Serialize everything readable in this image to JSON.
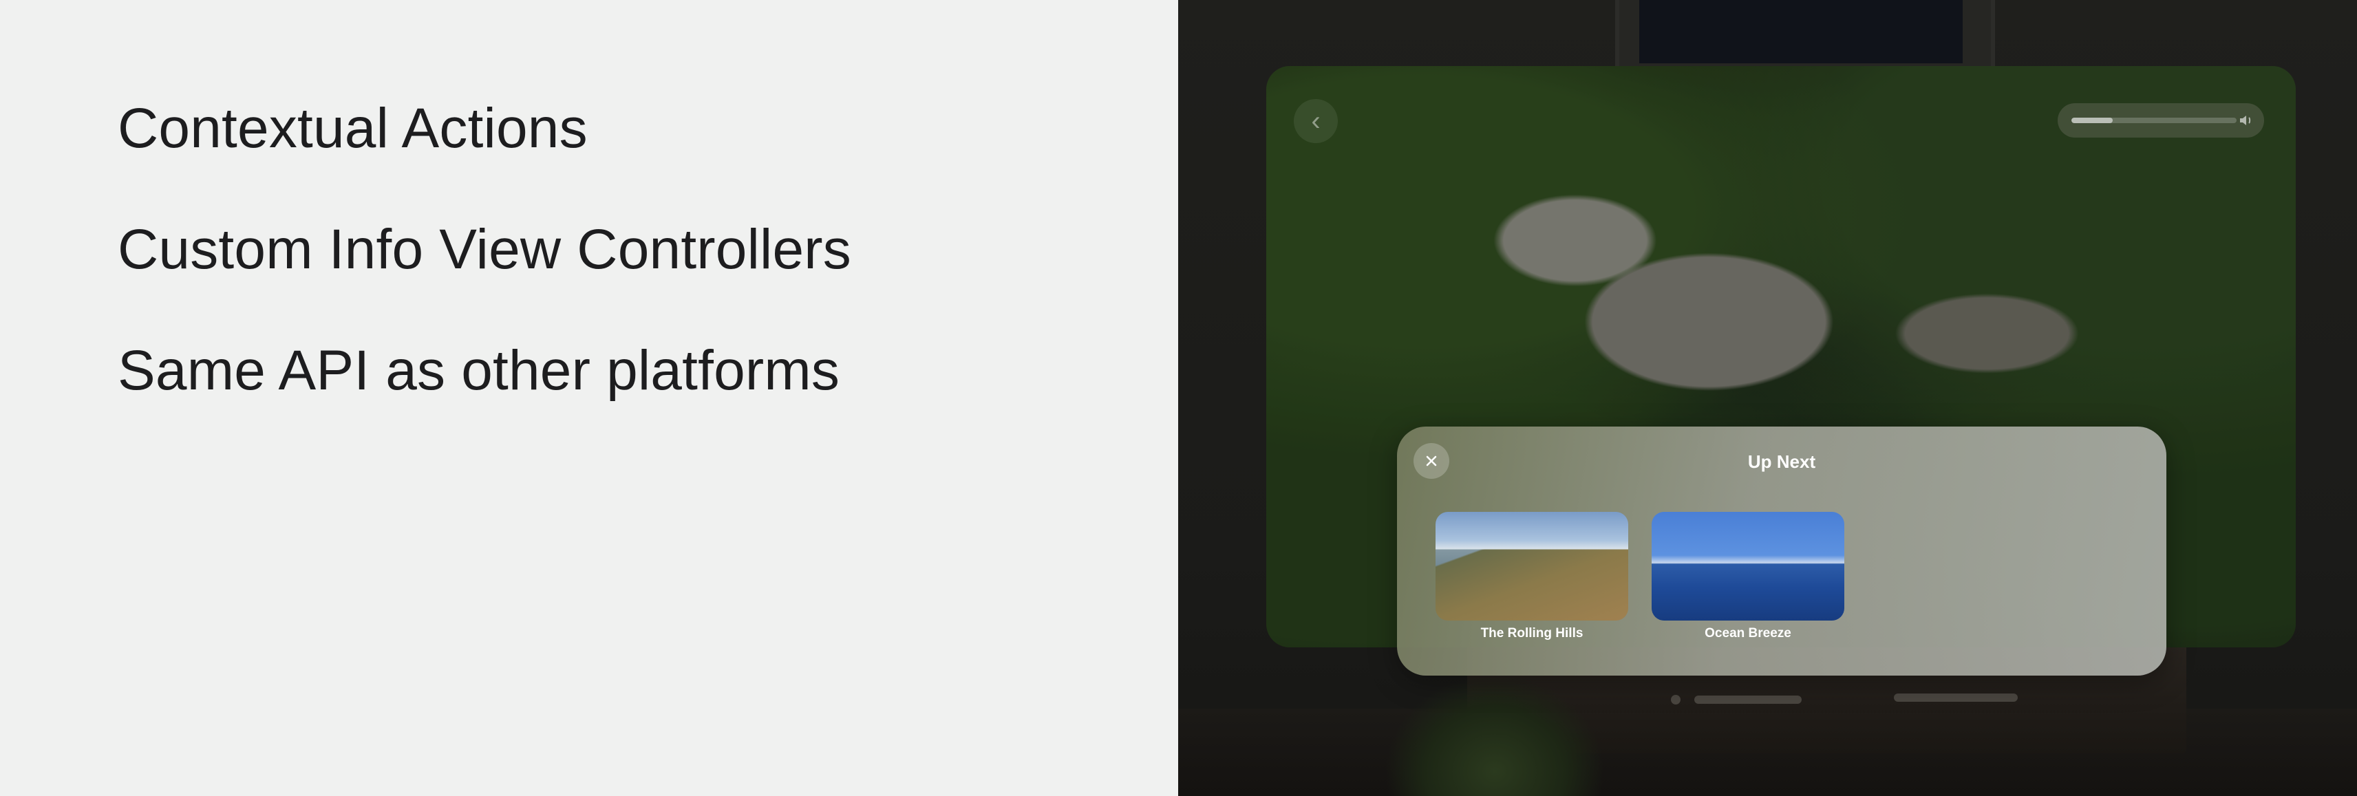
{
  "slide": {
    "bullets": [
      "Contextual Actions",
      "Custom Info View Controllers",
      "Same API as other platforms"
    ]
  },
  "player": {
    "back_icon": "chevron-left-icon",
    "volume_icon": "speaker-icon",
    "volume_level": 0.25
  },
  "up_next": {
    "title": "Up Next",
    "close_icon": "close-icon",
    "items": [
      {
        "label": "The Rolling Hills"
      },
      {
        "label": "Ocean Breeze"
      }
    ]
  }
}
